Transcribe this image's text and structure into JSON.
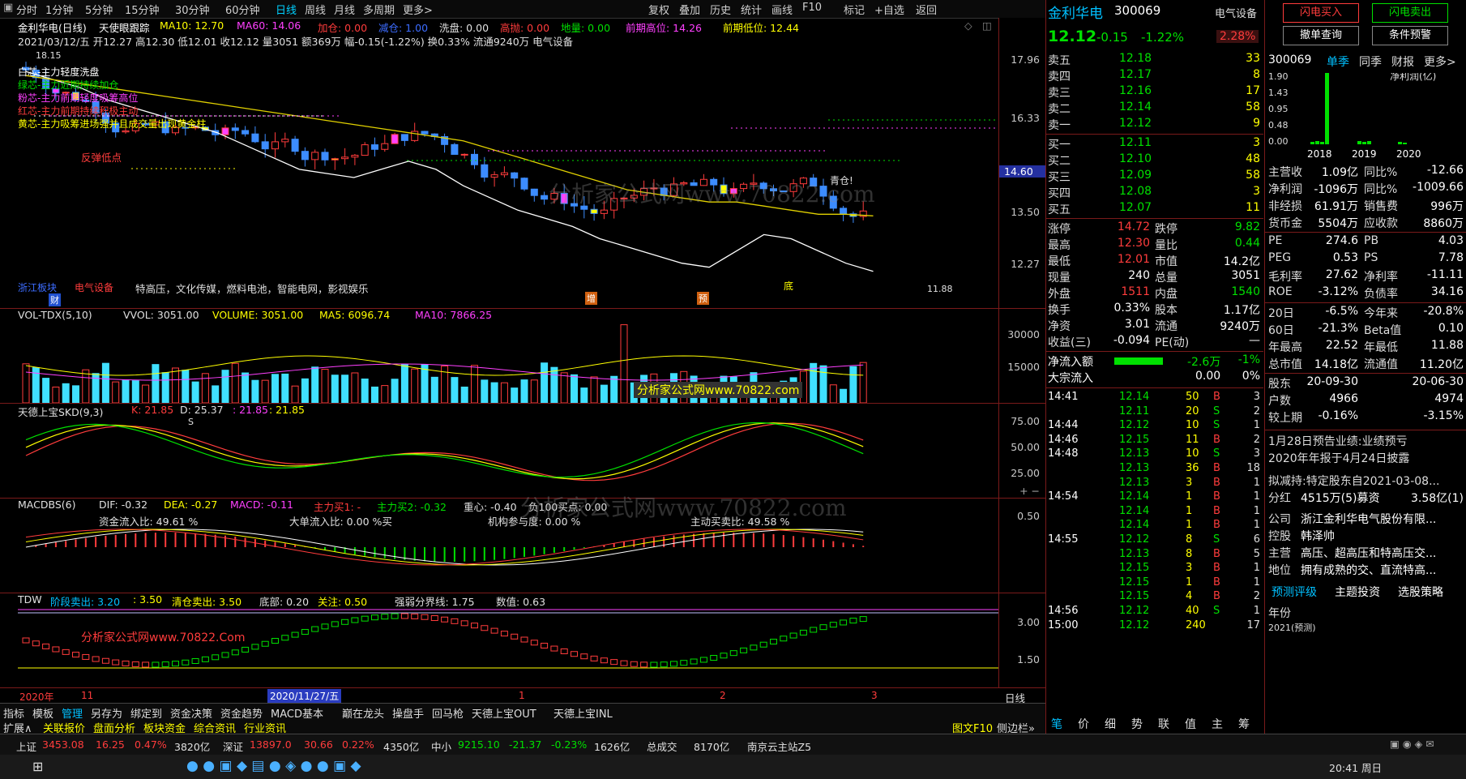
{
  "topbar": {
    "periods": [
      "分时",
      "1分钟",
      "5分钟",
      "15分钟",
      "30分钟",
      "60分钟",
      "日线",
      "周线",
      "月线",
      "多周期",
      "更多>"
    ],
    "active_period": "日线",
    "tools": [
      "复权",
      "叠加",
      "历史",
      "统计",
      "画线",
      "F10",
      "标记",
      "+自选",
      "返回"
    ]
  },
  "header": {
    "stock_name": "金利华电(日线)",
    "indicator": "天使眼跟踪",
    "ma10": "MA10: 12.70",
    "ma60": "MA60: 14.06",
    "jiacang": "加仓: 0.00",
    "jiancang": "减仓: 1.00",
    "xipan": "洗盘: 0.00",
    "gaopao": "高抛: 0.00",
    "diya": "地量: 0.00",
    "prev_high": "前期高位: 14.26",
    "prev_low": "前期低位: 12.44",
    "info_line": "2021/03/12/五  开12.27  高12.30  低12.01  收12.12  量3051  额369万  幅-0.15(-1.22%)  换0.33%  流通9240万  电气设备"
  },
  "price_pane": {
    "axis": [
      "17.96",
      "16.33",
      "14.60",
      "13.50",
      "12.27"
    ],
    "current_tag": "14.60",
    "high_mark": "18.15",
    "low_mark": "11.88",
    "legend": [
      "白芯-主力轻度洗盘",
      "绿芯-主力近期持续加仓",
      "粉芯-主力前期轻度吸筹高位",
      "红芯-主力前期持续积极主动",
      "黄芯-主力吸筹进场强并且成交量出现黄金柱"
    ],
    "annotations": [
      "反弹低点",
      "青仓!",
      "底",
      "增",
      "预"
    ],
    "concepts": "特高压，文化传媒，燃料电池，智能电网，影视娱乐",
    "sector_label": "电气设备",
    "sector_prefix": "浙江板块",
    "cai_label": "财"
  },
  "vol_pane": {
    "title": "VOL-TDX(5,10)",
    "vvol": "VVOL: 3051.00",
    "volume": "VOLUME: 3051.00",
    "ma5": "MA5: 6096.74",
    "ma10": "MA10: 7866.25",
    "axis": [
      "30000",
      "15000"
    ]
  },
  "skd_pane": {
    "title": "天德上宝SKD(9,3)",
    "k": "K: 21.85",
    "d": "D: 25.37",
    "j": ": 21.85",
    "j2": ": 21.85",
    "axis": [
      "75.00",
      "50.00",
      "25.00"
    ],
    "s_mark": "S"
  },
  "macd_pane": {
    "title": "MACDBS(6)",
    "dif": "DIF: -0.32",
    "dea": "DEA: -0.27",
    "macd": "MACD: -0.11",
    "buy1": "主力买1: -",
    "buy2": "主力买2: -0.32",
    "center": "重心: -0.40",
    "neg100": "负100买点: 0.00",
    "fund_in": "资金流入比:  49.61 %",
    "big_in": "大单流入比:  0.00 %买",
    "inst": "机构参与度:  0.00 %",
    "active": "主动买卖比:  49.58 %",
    "axis": [
      "0.50"
    ]
  },
  "tdw_pane": {
    "title": "TDW",
    "stage_sell": "阶段卖出: 3.20",
    "val350": ": 3.50",
    "clear": "清仓卖出: 3.50",
    "bottom": "底部: 0.20",
    "focus": "关注: 0.50",
    "boundary": "强弱分界线: 1.75",
    "value": "数值: 0.63",
    "axis": [
      "3.00",
      "1.50"
    ]
  },
  "date_axis": {
    "year": "2020年",
    "m11": "11",
    "cursor_date": "2020/11/27/五",
    "m1": "1",
    "m2": "2",
    "m3": "3",
    "period_btn": "日线"
  },
  "bottom_tabs": {
    "row1": [
      "指标",
      "模板",
      "管理",
      "另存为",
      "绑定到",
      "资金决策",
      "资金趋势",
      "MACD基本",
      "巅在龙头",
      "操盘手",
      "回马枪",
      "天德上宝OUT",
      "天德上宝INL"
    ],
    "row2": [
      "扩展∧",
      "关联报价",
      "盘面分析",
      "板块资金",
      "综合资讯",
      "行业资讯"
    ],
    "right": "图文F10",
    "right2": "侧边栏»"
  },
  "quote": {
    "name": "金利华电",
    "code": "300069",
    "sector": "电气设备",
    "price": "12.12",
    "change": "-0.15",
    "pct": "-1.22%",
    "sector_pct": "2.28%",
    "sells": [
      {
        "label": "卖五",
        "price": "12.18",
        "vol": "33"
      },
      {
        "label": "卖四",
        "price": "12.17",
        "vol": "8"
      },
      {
        "label": "卖三",
        "price": "12.16",
        "vol": "17"
      },
      {
        "label": "卖二",
        "price": "12.14",
        "vol": "58"
      },
      {
        "label": "卖一",
        "price": "12.12",
        "vol": "9"
      }
    ],
    "buys": [
      {
        "label": "买一",
        "price": "12.11",
        "vol": "3"
      },
      {
        "label": "买二",
        "price": "12.10",
        "vol": "48"
      },
      {
        "label": "买三",
        "price": "12.09",
        "vol": "58"
      },
      {
        "label": "买四",
        "price": "12.08",
        "vol": "3"
      },
      {
        "label": "买五",
        "price": "12.07",
        "vol": "11"
      }
    ],
    "stats": [
      {
        "l": "涨停",
        "v": "14.72",
        "l2": "跌停",
        "v2": "9.82"
      },
      {
        "l": "最高",
        "v": "12.30",
        "l2": "量比",
        "v2": "0.44"
      },
      {
        "l": "最低",
        "v": "12.01",
        "l2": "市值",
        "v2": "14.2亿"
      },
      {
        "l": "现量",
        "v": "240",
        "l2": "总量",
        "v2": "3051"
      },
      {
        "l": "外盘",
        "v": "1511",
        "l2": "内盘",
        "v2": "1540"
      },
      {
        "l": "换手",
        "v": "0.33%",
        "l2": "股本",
        "v2": "1.17亿"
      },
      {
        "l": "净资",
        "v": "3.01",
        "l2": "流通",
        "v2": "9240万"
      },
      {
        "l": "收益(三)",
        "v": "-0.094",
        "l2": "PE(动)",
        "v2": "—"
      }
    ],
    "netflow_label": "净流入额",
    "netflow": "-2.6万",
    "netflow_pct": "-1%",
    "bigflow_label": "大宗流入",
    "bigflow": "0.00",
    "bigflow_pct": "0%",
    "ticks": [
      {
        "t": "14:41",
        "p": "12.14",
        "v": "50",
        "s": "B",
        "n": "3"
      },
      {
        "t": "",
        "p": "12.11",
        "v": "20",
        "s": "S",
        "n": "2"
      },
      {
        "t": "14:44",
        "p": "12.12",
        "v": "10",
        "s": "S",
        "n": "1"
      },
      {
        "t": "14:46",
        "p": "12.15",
        "v": "11",
        "s": "B",
        "n": "2"
      },
      {
        "t": "14:48",
        "p": "12.13",
        "v": "10",
        "s": "S",
        "n": "3"
      },
      {
        "t": "",
        "p": "12.13",
        "v": "36",
        "s": "B",
        "n": "18"
      },
      {
        "t": "",
        "p": "12.13",
        "v": "3",
        "s": "B",
        "n": "1"
      },
      {
        "t": "14:54",
        "p": "12.14",
        "v": "1",
        "s": "B",
        "n": "1"
      },
      {
        "t": "",
        "p": "12.14",
        "v": "1",
        "s": "B",
        "n": "1"
      },
      {
        "t": "",
        "p": "12.14",
        "v": "1",
        "s": "B",
        "n": "1"
      },
      {
        "t": "14:55",
        "p": "12.12",
        "v": "8",
        "s": "S",
        "n": "6"
      },
      {
        "t": "",
        "p": "12.13",
        "v": "8",
        "s": "B",
        "n": "5"
      },
      {
        "t": "",
        "p": "12.15",
        "v": "3",
        "s": "B",
        "n": "1"
      },
      {
        "t": "",
        "p": "12.15",
        "v": "1",
        "s": "B",
        "n": "1"
      },
      {
        "t": "",
        "p": "12.15",
        "v": "4",
        "s": "B",
        "n": "2"
      },
      {
        "t": "14:56",
        "p": "12.12",
        "v": "40",
        "s": "S",
        "n": "1"
      },
      {
        "t": "15:00",
        "p": "12.12",
        "v": "240",
        "s": "",
        "n": "17"
      }
    ],
    "bottom_tabs": [
      "笔",
      "价",
      "细",
      "势",
      "联",
      "值",
      "主",
      "筹"
    ]
  },
  "far": {
    "btn_buy": "闪电买入",
    "btn_sell": "闪电卖出",
    "btn_cancel": "撤单查询",
    "btn_cond": "条件预警",
    "code": "300069",
    "tabs": [
      "单季",
      "同季",
      "财报",
      "更多>"
    ],
    "chart_label": "净利润(亿)",
    "chart_axis": [
      "1.90",
      "1.43",
      "0.95",
      "0.48",
      "0.00"
    ],
    "chart_years": [
      "2018",
      "2019",
      "2020"
    ],
    "fins": [
      {
        "l": "主营收",
        "v": "1.09亿",
        "l2": "同比%",
        "v2": "-12.66"
      },
      {
        "l": "净利润",
        "v": "-1096万",
        "l2": "同比%",
        "v2": "-1009.66"
      },
      {
        "l": "非经损",
        "v": "61.91万",
        "l2": "销售费",
        "v2": "996万"
      },
      {
        "l": "货币金",
        "v": "5504万",
        "l2": "应收款",
        "v2": "8860万"
      },
      {
        "l": "PE",
        "v": "274.6",
        "l2": "PB",
        "v2": "4.03"
      },
      {
        "l": "PEG",
        "v": "0.53",
        "l2": "PS",
        "v2": "7.78"
      },
      {
        "l": "毛利率",
        "v": "27.62",
        "l2": "净利率",
        "v2": "-11.11"
      },
      {
        "l": "ROE",
        "v": "-3.12%",
        "l2": "负债率",
        "v2": "34.16"
      },
      {
        "l": "20日",
        "v": "-6.5%",
        "l2": "今年来",
        "v2": "-20.8%"
      },
      {
        "l": "60日",
        "v": "-21.3%",
        "l2": "Beta值",
        "v2": "0.10"
      },
      {
        "l": "年最高",
        "v": "22.52",
        "l2": "年最低",
        "v2": "11.88"
      },
      {
        "l": "总市值",
        "v": "14.18亿",
        "l2": "流通值",
        "v2": "11.20亿"
      },
      {
        "l": "股东",
        "v": "20-09-30",
        "l2": "",
        "v2": "20-06-30"
      },
      {
        "l": "户数",
        "v": "4966",
        "l2": "",
        "v2": "4974"
      },
      {
        "l": "较上期",
        "v": "-0.16%",
        "l2": "",
        "v2": "-3.15%"
      }
    ],
    "notes": [
      "1月28日预告业绩:业绩预亏",
      "2020年年报于4月24日披露",
      "拟减持:特定股东自2021-03-08..."
    ],
    "fenhong": "分红",
    "fenhong_v": "4515万(5)募资",
    "fenhong_v2": "3.58亿(1)",
    "company_rows": [
      {
        "l": "公司",
        "v": "浙江金利华电气股份有限..."
      },
      {
        "l": "控股",
        "v": "韩泽帅"
      },
      {
        "l": "主营",
        "v": "高压、超高压和特高压交..."
      },
      {
        "l": "地位",
        "v": "拥有成熟的交、直流特高..."
      }
    ],
    "bottom_tabs": [
      "预测评级",
      "主题投资",
      "选股策略"
    ],
    "year_label": "年份",
    "year_value": "2021(预测)"
  },
  "status": {
    "sh_label": "上证",
    "sh": "3453.08",
    "sh_chg": "16.25",
    "sh_pct": "0.47%",
    "sh_amt": "3820亿",
    "sz_label": "深证",
    "sz": "13897.0",
    "sz_chg": "30.66",
    "sz_pct": "0.22%",
    "sz_amt": "4350亿",
    "zx_label": "中小",
    "zx": "9215.10",
    "zx_chg": "-21.37",
    "zx_pct": "-0.23%",
    "zx_amt": "1626亿",
    "total_label": "总成交",
    "total": "8170亿",
    "server": "南京云主站Z5"
  },
  "watermark": "分析家公式网www.70822.com",
  "watermark2": "分析家公式网www.70822.Com",
  "taskbar": {
    "time": "20:41 周日"
  },
  "chart_data": {
    "type": "candlestick",
    "series": [
      {
        "name": "MA10",
        "values": [
          17.6,
          17.4,
          17.2,
          16.9,
          16.7,
          16.5,
          16.3,
          16.1,
          15.8,
          15.5,
          15.2,
          15.1,
          15.0,
          15.2,
          15.4,
          15.2,
          14.8,
          14.5,
          14.2,
          14.0,
          13.8,
          13.5,
          13.3,
          13.1,
          12.9,
          12.8,
          13.2,
          13.6,
          13.5,
          13.2,
          12.9,
          12.7
        ]
      },
      {
        "name": "MA60",
        "values": [
          17.5,
          17.4,
          17.3,
          17.2,
          17.1,
          17.0,
          16.9,
          16.8,
          16.7,
          16.6,
          16.5,
          16.4,
          16.3,
          16.2,
          16.1,
          16.0,
          15.9,
          15.7,
          15.5,
          15.3,
          15.1,
          14.9,
          14.7,
          14.6,
          14.5,
          14.4,
          14.4,
          14.3,
          14.2,
          14.1,
          14.1,
          14.06
        ]
      }
    ],
    "ylim": [
      11.8,
      18.2
    ]
  }
}
